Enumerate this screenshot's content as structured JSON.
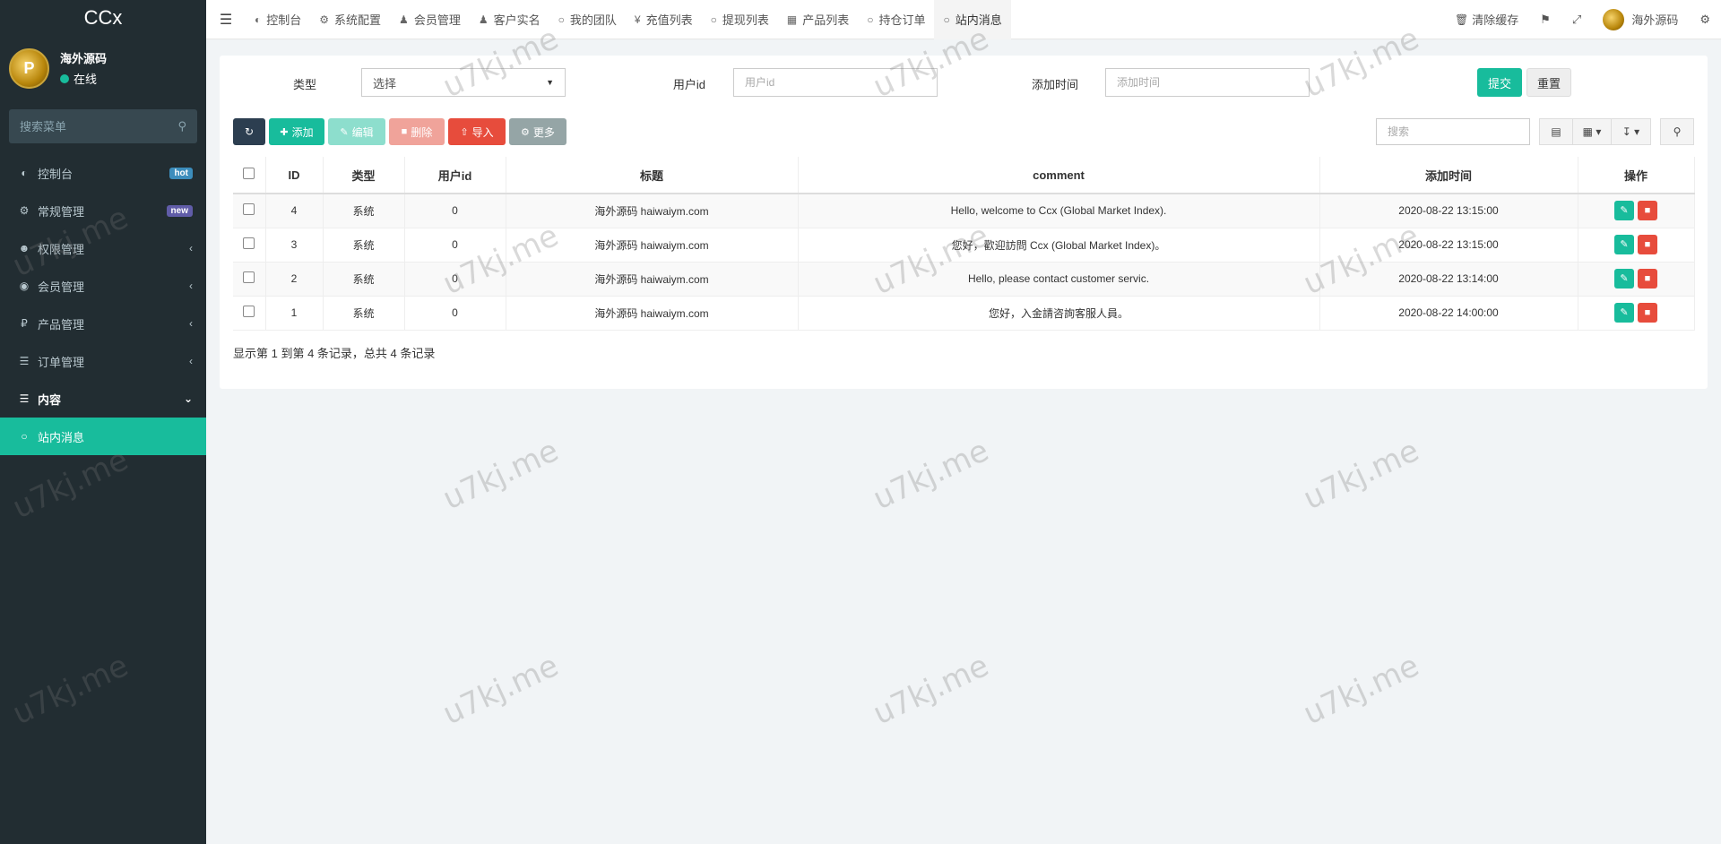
{
  "sidebar": {
    "logo": "CCx",
    "user": {
      "name": "海外源码",
      "status": "在线"
    },
    "search_placeholder": "搜索菜单",
    "items": [
      {
        "label": "控制台",
        "badge": "hot"
      },
      {
        "label": "常规管理",
        "badge": "new"
      },
      {
        "label": "权限管理"
      },
      {
        "label": "会员管理"
      },
      {
        "label": "产品管理"
      },
      {
        "label": "订单管理"
      },
      {
        "label": "内容"
      },
      {
        "label": "站内消息"
      }
    ]
  },
  "topbar": {
    "tabs": [
      "控制台",
      "系统配置",
      "会员管理",
      "客户实名",
      "我的团队",
      "充值列表",
      "提现列表",
      "产品列表",
      "持仓订单",
      "站内消息"
    ],
    "clear_cache": "清除缓存",
    "user_name": "海外源码"
  },
  "filters": {
    "type_label": "类型",
    "type_value": "选择",
    "userid_label": "用户id",
    "userid_placeholder": "用户id",
    "time_label": "添加时间",
    "time_placeholder": "添加时间",
    "submit": "提交",
    "reset": "重置"
  },
  "toolbar": {
    "add": "添加",
    "edit": "编辑",
    "delete": "删除",
    "import": "导入",
    "more": "更多",
    "search_placeholder": "搜索"
  },
  "table": {
    "headers": [
      "ID",
      "类型",
      "用户id",
      "标题",
      "comment",
      "添加时间",
      "操作"
    ],
    "rows": [
      {
        "id": "4",
        "type": "系统",
        "userid": "0",
        "title": "海外源码 haiwaiym.com",
        "comment": "Hello, welcome to Ccx (Global Market Index).",
        "time": "2020-08-22 13:15:00"
      },
      {
        "id": "3",
        "type": "系统",
        "userid": "0",
        "title": "海外源码 haiwaiym.com",
        "comment": "您好，歡迎訪問 Ccx (Global Market Index)。",
        "time": "2020-08-22 13:15:00"
      },
      {
        "id": "2",
        "type": "系统",
        "userid": "0",
        "title": "海外源码 haiwaiym.com",
        "comment": "Hello, please contact customer servic.",
        "time": "2020-08-22 13:14:00"
      },
      {
        "id": "1",
        "type": "系统",
        "userid": "0",
        "title": "海外源码 haiwaiym.com",
        "comment": "您好，入金請咨詢客服人員。",
        "time": "2020-08-22 14:00:00"
      }
    ]
  },
  "pager_text": "显示第 1 到第 4 条记录，总共 4 条记录",
  "watermark": "u7kj.me",
  "colors": {
    "sidebar_bg": "#222d32",
    "accent": "#18bc9c",
    "danger": "#e74c3c"
  }
}
